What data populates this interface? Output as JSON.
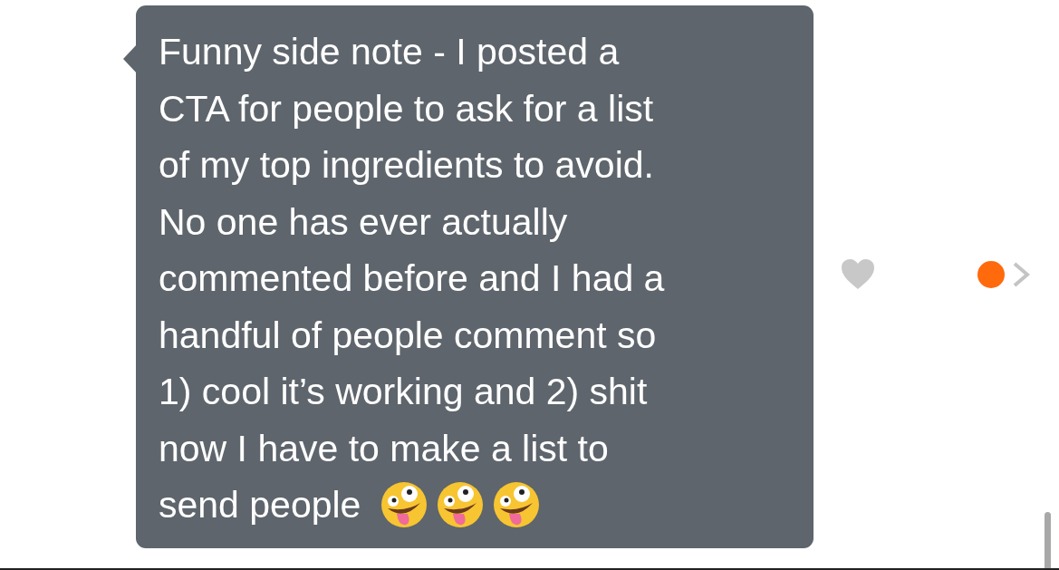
{
  "message": {
    "lines": [
      "Funny side note - I posted a",
      "CTA for people to ask for a list",
      "of my top ingredients to avoid.",
      "No one has ever actually",
      "commented before and I had a",
      "handful of people comment so",
      "1) cool it’s working and 2) shit",
      "now I have to make a list to",
      "send people"
    ],
    "emojis": [
      {
        "kind": "zany"
      },
      {
        "kind": "zany"
      },
      {
        "kind": "zany"
      }
    ],
    "liked": false,
    "unread_dot": {
      "color": "#ff6a0d"
    }
  }
}
